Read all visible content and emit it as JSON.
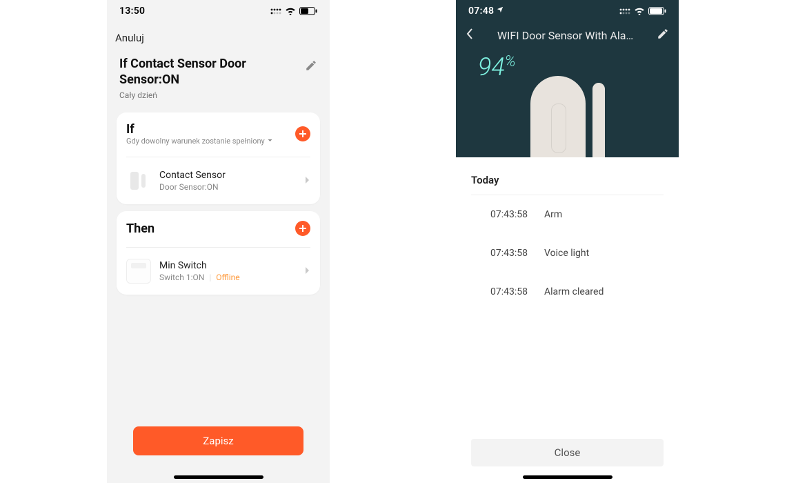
{
  "left": {
    "status": {
      "time": "13:50"
    },
    "cancel_label": "Anuluj",
    "title": "If Contact Sensor Door Sensor:ON",
    "subtitle": "Cały dzień",
    "if_card": {
      "title": "If",
      "subtitle": "Gdy dowolny warunek zostanie spełniony",
      "items": [
        {
          "name": "Contact Sensor",
          "sub": "Door Sensor:ON"
        }
      ]
    },
    "then_card": {
      "title": "Then",
      "items": [
        {
          "name": "Min Switch",
          "sub": "Switch 1:ON",
          "status": "Offline"
        }
      ]
    },
    "save_label": "Zapisz"
  },
  "right": {
    "status": {
      "time": "07:48"
    },
    "header_title": "WIFI Door Sensor With Ala…",
    "percent": "94",
    "log": {
      "today_label": "Today",
      "items": [
        {
          "time": "07:43:58",
          "event": "Arm"
        },
        {
          "time": "07:43:58",
          "event": "Voice light"
        },
        {
          "time": "07:43:58",
          "event": "Alarm cleared"
        }
      ]
    },
    "close_label": "Close"
  }
}
